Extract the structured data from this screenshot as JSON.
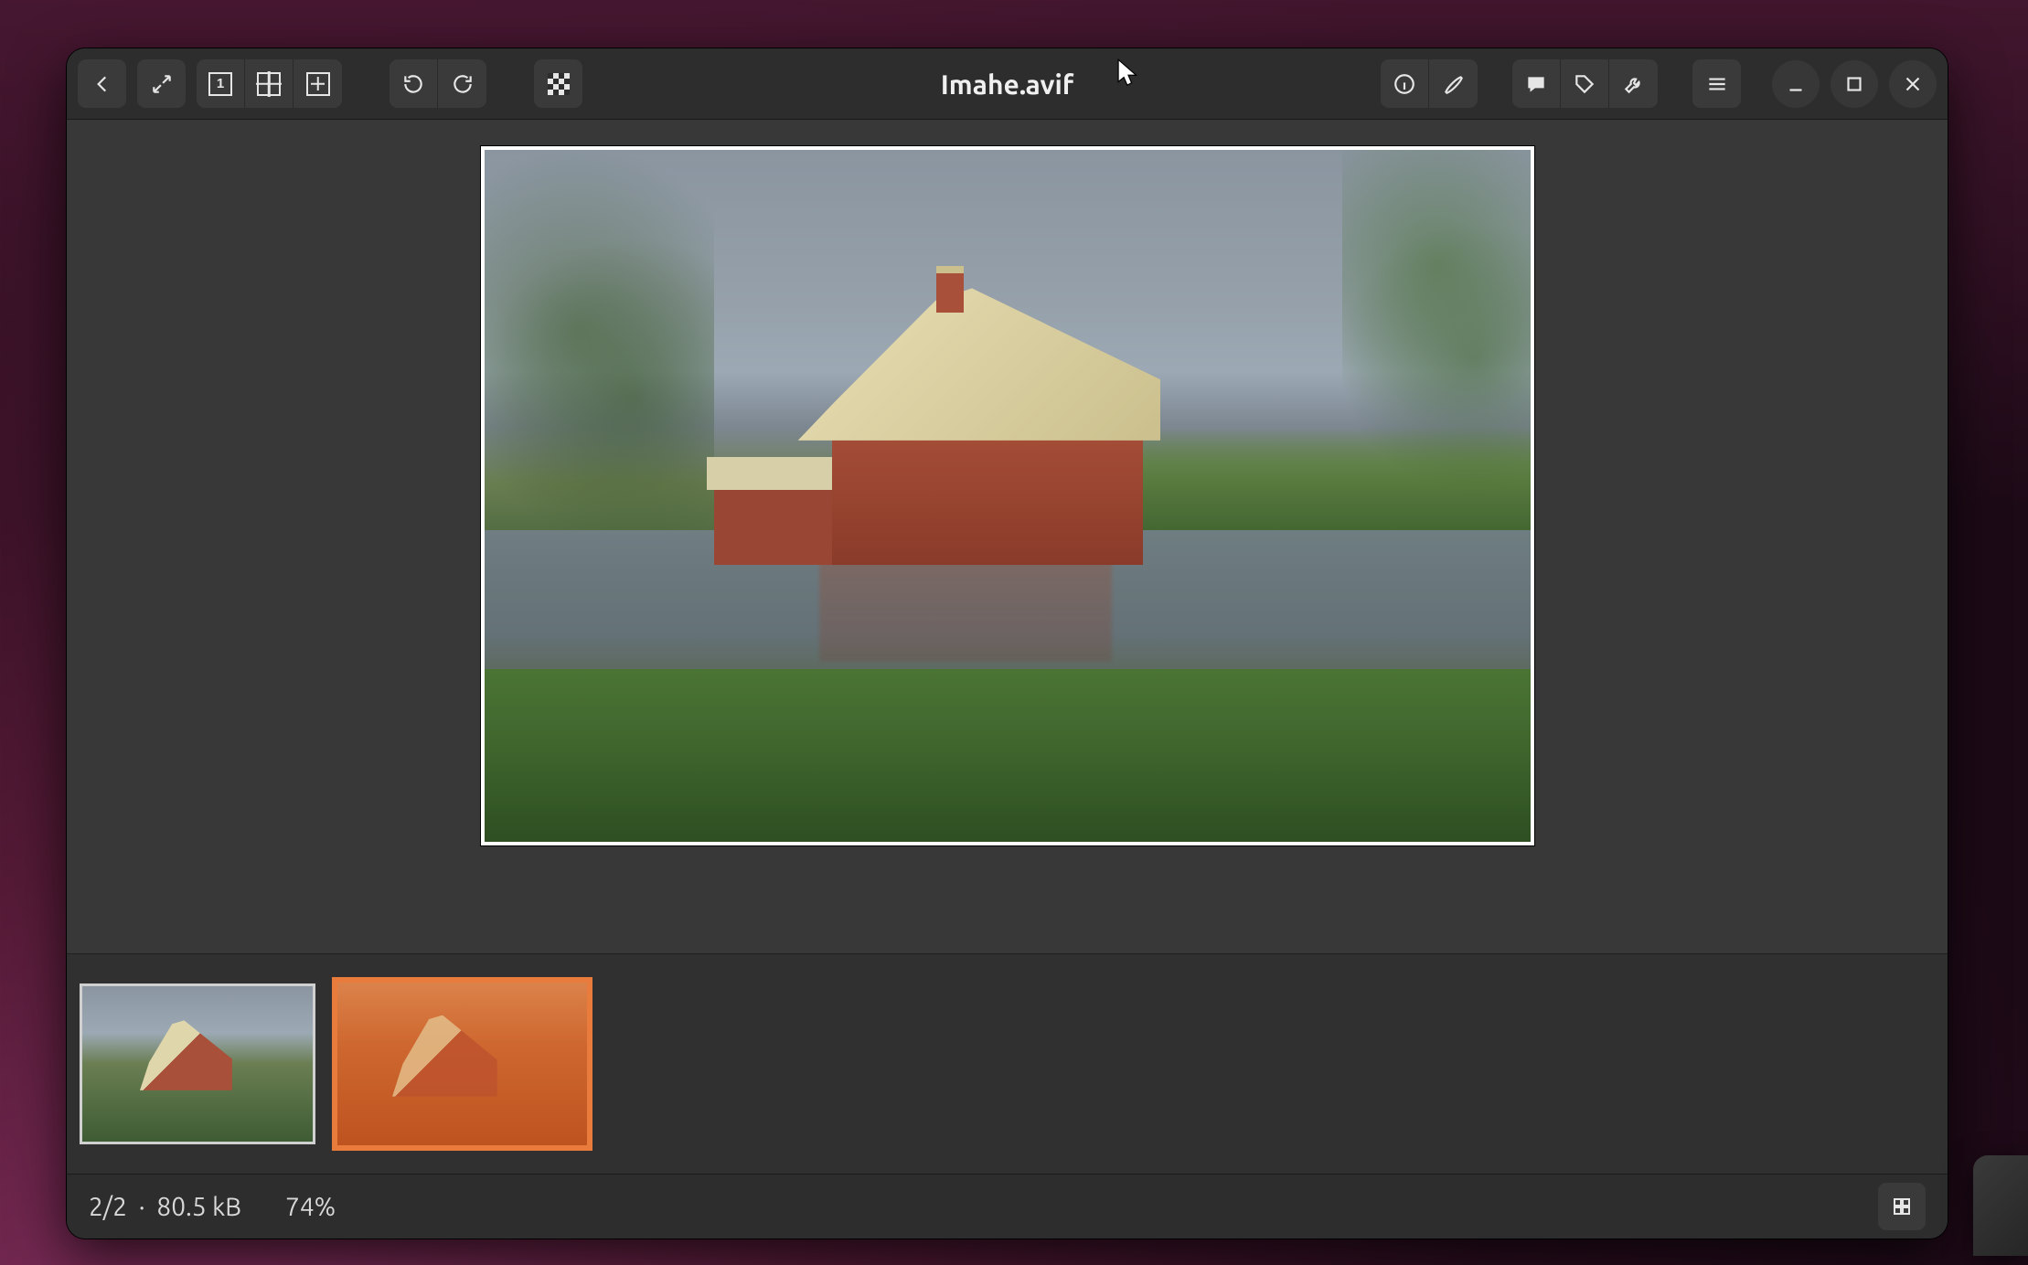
{
  "window": {
    "title": "Imahe.avif"
  },
  "toolbar": {
    "back": "back-icon",
    "fullscreen": "fullscreen-icon",
    "zoom100_label": "1",
    "zoom_fit": "zoom-fit-icon",
    "zoom_in": "zoom-in-icon",
    "rotate_ccw": "rotate-ccw-icon",
    "rotate_cw": "rotate-cw-icon",
    "transparency": "transparency-icon",
    "info": "info-icon",
    "edit": "edit-icon",
    "comment": "comment-icon",
    "tag": "tag-icon",
    "tools": "tools-icon",
    "menu": "menu-icon",
    "minimize": "minimize-icon",
    "maximize": "maximize-icon",
    "close": "close-icon"
  },
  "status": {
    "position_and_size": "2/2  ·  80.5 kB",
    "zoom": "74%"
  },
  "thumbnails": [
    {
      "selected": false,
      "variant": "normal"
    },
    {
      "selected": true,
      "variant": "tinted"
    }
  ],
  "colors": {
    "accent": "#e97b3c",
    "window_bg": "#2a2a2a",
    "toolbar_bg": "#2d2d2d",
    "canvas_bg": "#383838"
  }
}
